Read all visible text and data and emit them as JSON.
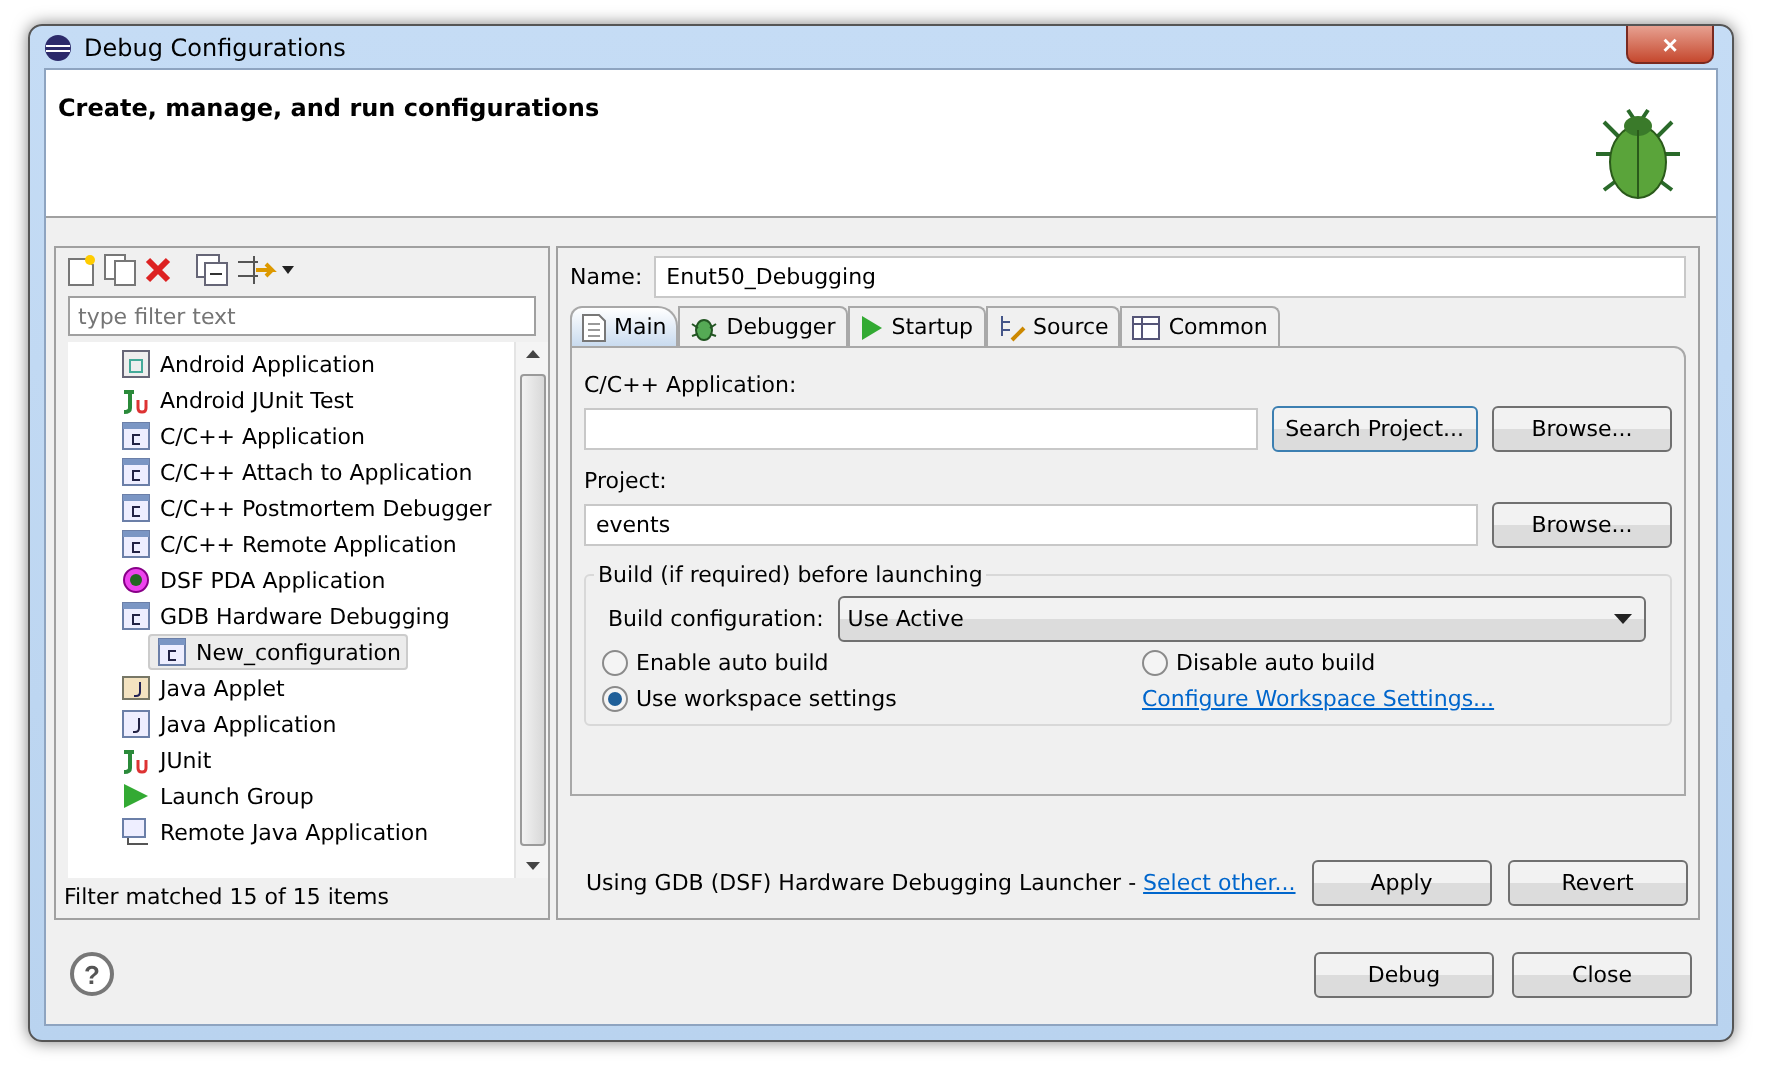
{
  "window": {
    "title": "Debug Configurations",
    "close": "×"
  },
  "header": {
    "message": "Create, manage, and run configurations"
  },
  "sidebar": {
    "filter_placeholder": "type filter text",
    "items": [
      {
        "label": "Android Application",
        "kind": "app",
        "selected": false
      },
      {
        "label": "Android JUnit Test",
        "kind": "junit",
        "selected": false
      },
      {
        "label": "C/C++ Application",
        "kind": "c",
        "selected": false
      },
      {
        "label": "C/C++ Attach to Application",
        "kind": "c",
        "selected": false
      },
      {
        "label": "C/C++ Postmortem Debugger",
        "kind": "c",
        "selected": false
      },
      {
        "label": "C/C++ Remote Application",
        "kind": "c",
        "selected": false
      },
      {
        "label": "DSF PDA Application",
        "kind": "dsf",
        "selected": false
      },
      {
        "label": "GDB Hardware Debugging",
        "kind": "c",
        "selected": false,
        "children": [
          {
            "label": "New_configuration",
            "kind": "c",
            "selected": true
          }
        ]
      },
      {
        "label": "Java Applet",
        "kind": "applet",
        "selected": false
      },
      {
        "label": "Java Application",
        "kind": "java",
        "selected": false
      },
      {
        "label": "JUnit",
        "kind": "junit",
        "selected": false
      },
      {
        "label": "Launch Group",
        "kind": "launch",
        "selected": false
      },
      {
        "label": "Remote Java Application",
        "kind": "remote",
        "selected": false
      }
    ],
    "status": "Filter matched 15 of 15 items"
  },
  "name": {
    "label": "Name:",
    "value": "Enut50_Debugging"
  },
  "tabs": [
    {
      "label": "Main",
      "kind": "main",
      "selected": true
    },
    {
      "label": "Debugger",
      "kind": "debugger",
      "selected": false
    },
    {
      "label": "Startup",
      "kind": "startup",
      "selected": false
    },
    {
      "label": "Source",
      "kind": "source",
      "selected": false
    },
    {
      "label": "Common",
      "kind": "common",
      "selected": false
    }
  ],
  "main": {
    "application_label": "C/C++ Application:",
    "search_button": "Search Project...",
    "browse_button": "Browse...",
    "project_label": "Project:",
    "project_value": "events",
    "project_browse": "Browse...",
    "build": {
      "title": "Build (if required) before launching",
      "config_label": "Build configuration:",
      "config_value": "Use Active",
      "options": [
        {
          "label": "Enable auto build",
          "selected": false
        },
        {
          "label": "Disable auto build",
          "selected": false
        },
        {
          "label": "Use workspace settings",
          "selected": true
        }
      ],
      "link": "Configure Workspace Settings..."
    }
  },
  "launcher": {
    "text": "Using GDB (DSF) Hardware Debugging Launcher - ",
    "link": "Select other..."
  },
  "actions": [
    "Apply",
    "Revert"
  ],
  "footer": {
    "help": "?",
    "buttons": [
      "Debug",
      "Close"
    ]
  }
}
